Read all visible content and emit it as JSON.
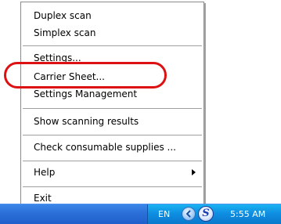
{
  "menu": {
    "items": [
      {
        "label": "Duplex scan"
      },
      {
        "label": "Simplex scan"
      },
      {
        "label": "Settings..."
      },
      {
        "label": "Carrier Sheet..."
      },
      {
        "label": "Settings Management"
      },
      {
        "label": "Show scanning results"
      },
      {
        "label": "Check consumable supplies ..."
      },
      {
        "label": "Help"
      },
      {
        "label": "Exit"
      }
    ]
  },
  "taskbar": {
    "language": "EN",
    "clock": "5:55 AM"
  },
  "icons": {
    "submenu": "submenu-arrow-icon",
    "tray_expand": "chevron-left-icon",
    "scanner": "scanner-s-icon"
  },
  "colors": {
    "highlight": "#dd1111",
    "taskbar": "#2b6fd8",
    "tray": "#0e8ce0"
  }
}
